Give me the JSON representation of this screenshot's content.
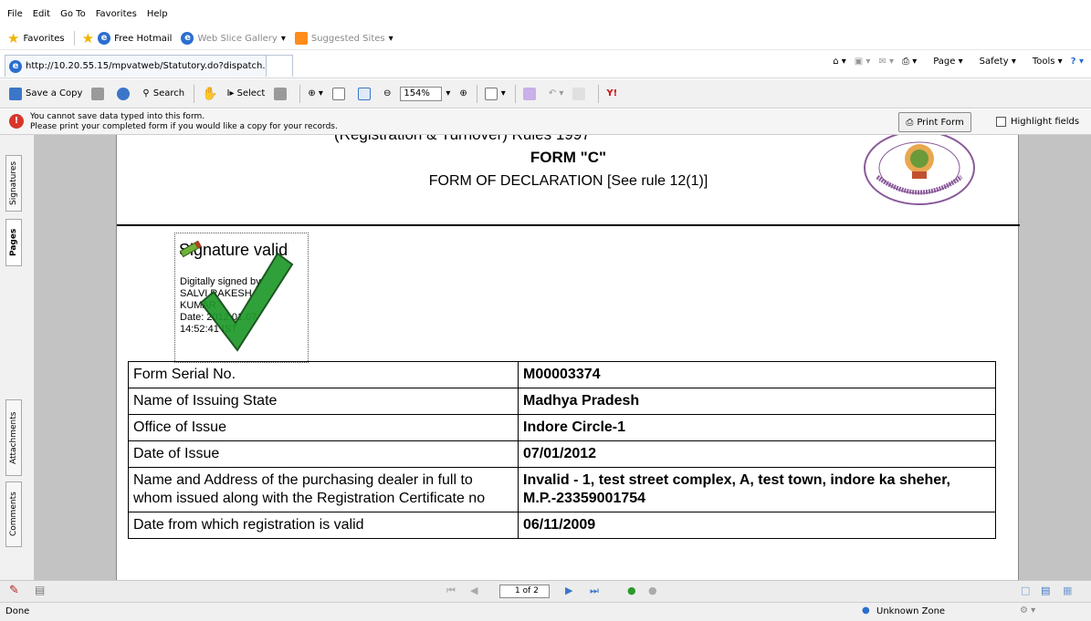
{
  "menu": [
    "File",
    "Edit",
    "Go To",
    "Favorites",
    "Help"
  ],
  "favorites_bar": {
    "favorites_label": "Favorites",
    "items": [
      "Free Hotmail",
      "Web Slice Gallery",
      "Suggested Sites"
    ]
  },
  "tab": {
    "title": "http://10.20.55.15/mpvatweb/Statutory.do?dispatch..."
  },
  "command_bar": [
    "Page",
    "Safety",
    "Tools"
  ],
  "acrobat_toolbar": {
    "save_copy": "Save a Copy",
    "search": "Search",
    "select": "Select",
    "zoom": "154%",
    "yahoo": "Y!"
  },
  "notice": {
    "line1": "You cannot save data typed into this form.",
    "line2": "Please print your completed form if you would like a copy for your records.",
    "print_button": "Print Form",
    "highlight_label": "Highlight fields"
  },
  "left_tabs": [
    "Signatures",
    "Pages",
    "Attachments",
    "Comments"
  ],
  "document": {
    "top_cut_text": "(Registration & Turnover) Rules 1997",
    "form_title": "FORM \"C\"",
    "form_subtitle": "FORM OF DECLARATION [See rule 12(1)]",
    "seal_text": "OFFICE OF COMMERCIAL TAX COMMISSIONER MADHYA PRADESH",
    "signature": {
      "title": "Signature valid",
      "lines": [
        "Digitally signed by",
        "SALVI RAKESH",
        "KUMAR",
        "Date: 2012.01.07",
        "14:52:41 IST"
      ]
    },
    "rows": [
      {
        "label": "Form Serial No.",
        "value": "M00003374"
      },
      {
        "label": "Name of Issuing State",
        "value": "Madhya Pradesh"
      },
      {
        "label": "Office of Issue",
        "value": "Indore Circle-1"
      },
      {
        "label": "Date of Issue",
        "value": "07/01/2012"
      },
      {
        "label": "Name and Address of the purchasing dealer in full to whom issued along with the Registration Certificate no",
        "value": "Invalid - 1, test street complex, A, test town, indore ka sheher, M.P.-23359001754"
      },
      {
        "label": "Date from which registration is valid",
        "value": "06/11/2009"
      }
    ]
  },
  "page_nav": {
    "page": "1 of 2"
  },
  "status": {
    "left": "Done",
    "zone": "Unknown Zone"
  }
}
